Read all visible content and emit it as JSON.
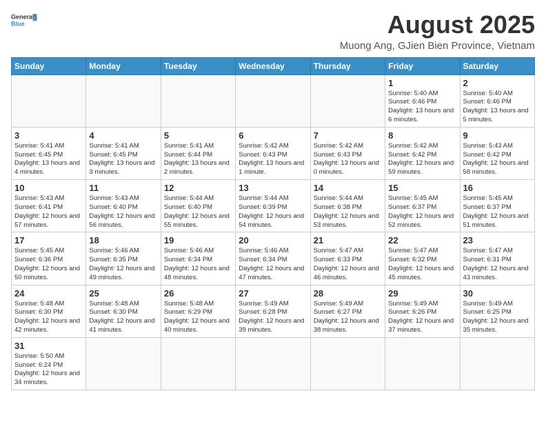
{
  "header": {
    "logo_general": "General",
    "logo_blue": "Blue",
    "month_year": "August 2025",
    "location": "Muong Ang, GJien Bien Province, Vietnam"
  },
  "days_of_week": [
    "Sunday",
    "Monday",
    "Tuesday",
    "Wednesday",
    "Thursday",
    "Friday",
    "Saturday"
  ],
  "weeks": [
    [
      {
        "day": "",
        "info": ""
      },
      {
        "day": "",
        "info": ""
      },
      {
        "day": "",
        "info": ""
      },
      {
        "day": "",
        "info": ""
      },
      {
        "day": "",
        "info": ""
      },
      {
        "day": "1",
        "info": "Sunrise: 5:40 AM\nSunset: 6:46 PM\nDaylight: 13 hours and 6 minutes."
      },
      {
        "day": "2",
        "info": "Sunrise: 5:40 AM\nSunset: 6:46 PM\nDaylight: 13 hours and 5 minutes."
      }
    ],
    [
      {
        "day": "3",
        "info": "Sunrise: 5:41 AM\nSunset: 6:45 PM\nDaylight: 13 hours and 4 minutes."
      },
      {
        "day": "4",
        "info": "Sunrise: 5:41 AM\nSunset: 6:45 PM\nDaylight: 13 hours and 3 minutes."
      },
      {
        "day": "5",
        "info": "Sunrise: 5:41 AM\nSunset: 6:44 PM\nDaylight: 13 hours and 2 minutes."
      },
      {
        "day": "6",
        "info": "Sunrise: 5:42 AM\nSunset: 6:43 PM\nDaylight: 13 hours and 1 minute."
      },
      {
        "day": "7",
        "info": "Sunrise: 5:42 AM\nSunset: 6:43 PM\nDaylight: 13 hours and 0 minutes."
      },
      {
        "day": "8",
        "info": "Sunrise: 5:42 AM\nSunset: 6:42 PM\nDaylight: 12 hours and 59 minutes."
      },
      {
        "day": "9",
        "info": "Sunrise: 5:43 AM\nSunset: 6:42 PM\nDaylight: 12 hours and 58 minutes."
      }
    ],
    [
      {
        "day": "10",
        "info": "Sunrise: 5:43 AM\nSunset: 6:41 PM\nDaylight: 12 hours and 57 minutes."
      },
      {
        "day": "11",
        "info": "Sunrise: 5:43 AM\nSunset: 6:40 PM\nDaylight: 12 hours and 56 minutes."
      },
      {
        "day": "12",
        "info": "Sunrise: 5:44 AM\nSunset: 6:40 PM\nDaylight: 12 hours and 55 minutes."
      },
      {
        "day": "13",
        "info": "Sunrise: 5:44 AM\nSunset: 6:39 PM\nDaylight: 12 hours and 54 minutes."
      },
      {
        "day": "14",
        "info": "Sunrise: 5:44 AM\nSunset: 6:38 PM\nDaylight: 12 hours and 53 minutes."
      },
      {
        "day": "15",
        "info": "Sunrise: 5:45 AM\nSunset: 6:37 PM\nDaylight: 12 hours and 52 minutes."
      },
      {
        "day": "16",
        "info": "Sunrise: 5:45 AM\nSunset: 6:37 PM\nDaylight: 12 hours and 51 minutes."
      }
    ],
    [
      {
        "day": "17",
        "info": "Sunrise: 5:45 AM\nSunset: 6:36 PM\nDaylight: 12 hours and 50 minutes."
      },
      {
        "day": "18",
        "info": "Sunrise: 5:46 AM\nSunset: 6:35 PM\nDaylight: 12 hours and 49 minutes."
      },
      {
        "day": "19",
        "info": "Sunrise: 5:46 AM\nSunset: 6:34 PM\nDaylight: 12 hours and 48 minutes."
      },
      {
        "day": "20",
        "info": "Sunrise: 5:46 AM\nSunset: 6:34 PM\nDaylight: 12 hours and 47 minutes."
      },
      {
        "day": "21",
        "info": "Sunrise: 5:47 AM\nSunset: 6:33 PM\nDaylight: 12 hours and 46 minutes."
      },
      {
        "day": "22",
        "info": "Sunrise: 5:47 AM\nSunset: 6:32 PM\nDaylight: 12 hours and 45 minutes."
      },
      {
        "day": "23",
        "info": "Sunrise: 5:47 AM\nSunset: 6:31 PM\nDaylight: 12 hours and 43 minutes."
      }
    ],
    [
      {
        "day": "24",
        "info": "Sunrise: 5:48 AM\nSunset: 6:30 PM\nDaylight: 12 hours and 42 minutes."
      },
      {
        "day": "25",
        "info": "Sunrise: 5:48 AM\nSunset: 6:30 PM\nDaylight: 12 hours and 41 minutes."
      },
      {
        "day": "26",
        "info": "Sunrise: 5:48 AM\nSunset: 6:29 PM\nDaylight: 12 hours and 40 minutes."
      },
      {
        "day": "27",
        "info": "Sunrise: 5:49 AM\nSunset: 6:28 PM\nDaylight: 12 hours and 39 minutes."
      },
      {
        "day": "28",
        "info": "Sunrise: 5:49 AM\nSunset: 6:27 PM\nDaylight: 12 hours and 38 minutes."
      },
      {
        "day": "29",
        "info": "Sunrise: 5:49 AM\nSunset: 6:26 PM\nDaylight: 12 hours and 37 minutes."
      },
      {
        "day": "30",
        "info": "Sunrise: 5:49 AM\nSunset: 6:25 PM\nDaylight: 12 hours and 35 minutes."
      }
    ],
    [
      {
        "day": "31",
        "info": "Sunrise: 5:50 AM\nSunset: 6:24 PM\nDaylight: 12 hours and 34 minutes."
      },
      {
        "day": "",
        "info": ""
      },
      {
        "day": "",
        "info": ""
      },
      {
        "day": "",
        "info": ""
      },
      {
        "day": "",
        "info": ""
      },
      {
        "day": "",
        "info": ""
      },
      {
        "day": "",
        "info": ""
      }
    ]
  ]
}
